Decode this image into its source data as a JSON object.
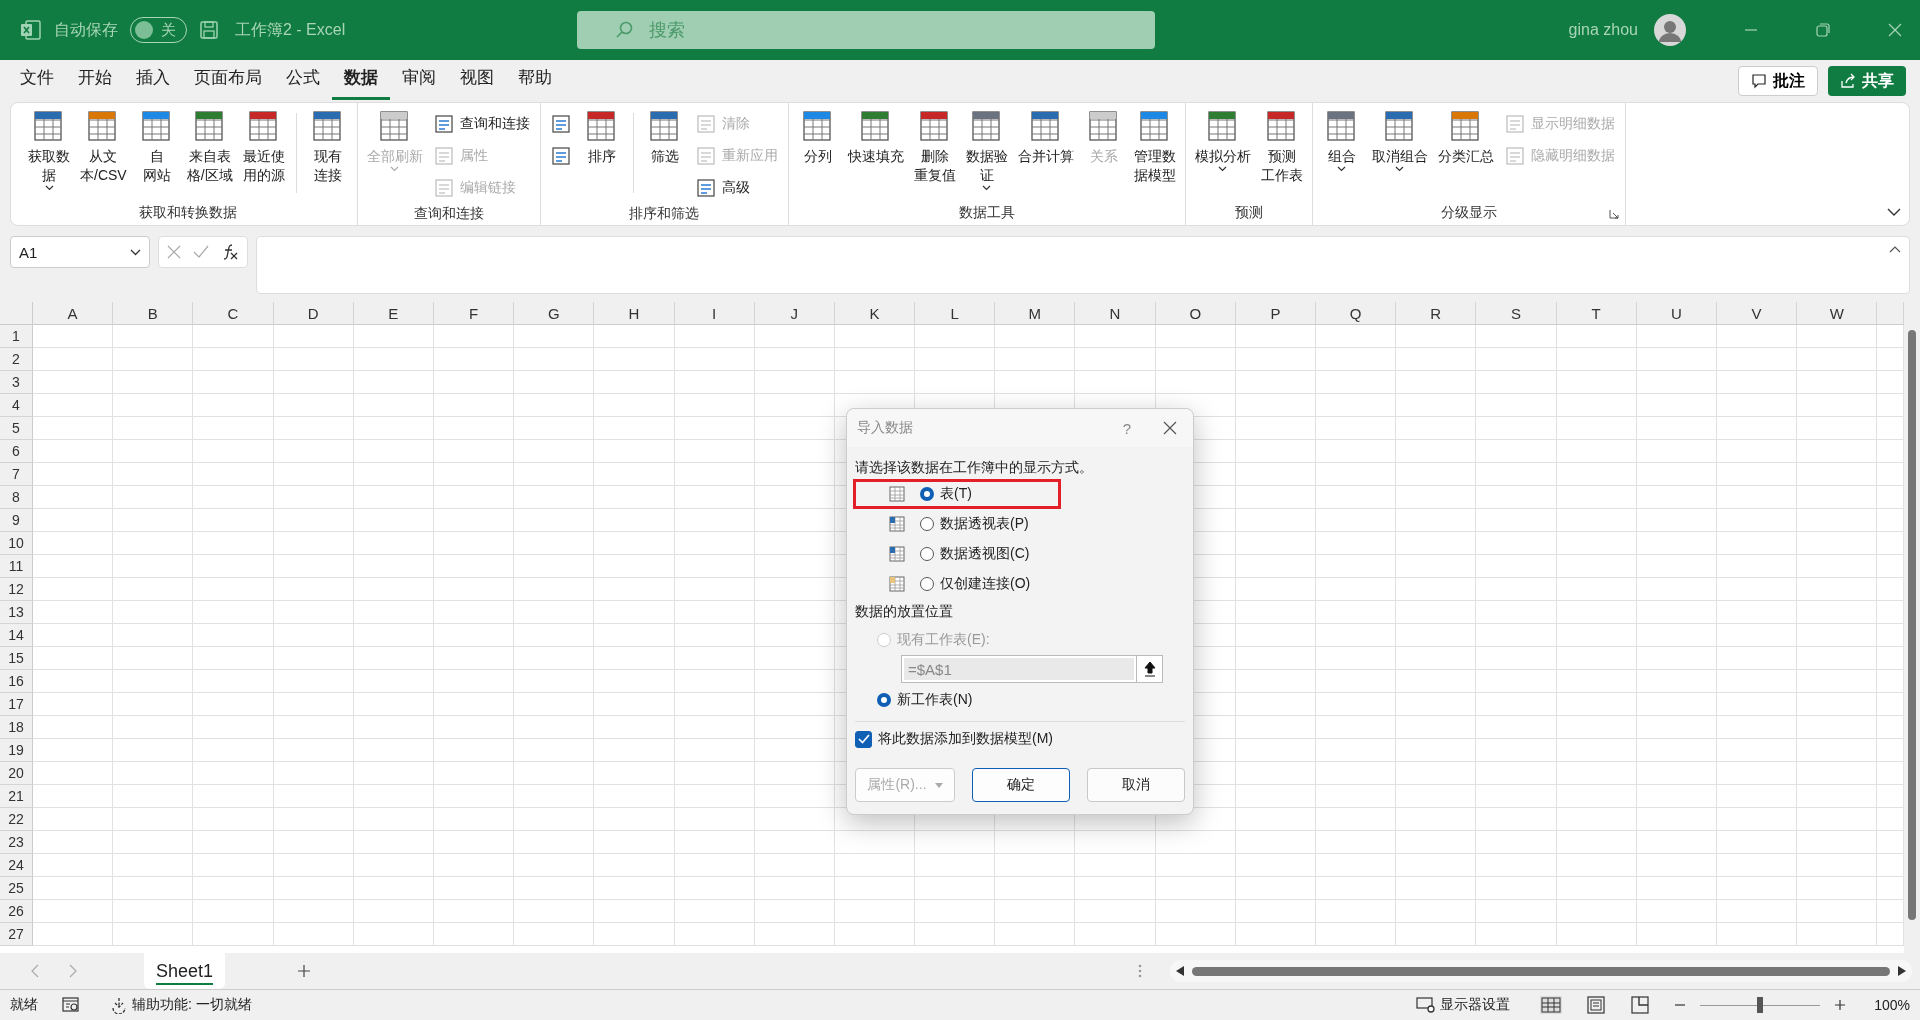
{
  "titlebar": {
    "autosave_label": "自动保存",
    "autosave_toggle": {
      "label": "关",
      "on": false
    },
    "title": "工作簿2  -  Excel",
    "search_placeholder": "搜索",
    "user": "gina zhou"
  },
  "menu_tabs": [
    {
      "label": "文件",
      "selected": false
    },
    {
      "label": "开始",
      "selected": false
    },
    {
      "label": "插入",
      "selected": false
    },
    {
      "label": "页面布局",
      "selected": false
    },
    {
      "label": "公式",
      "selected": false
    },
    {
      "label": "数据",
      "selected": true
    },
    {
      "label": "审阅",
      "selected": false
    },
    {
      "label": "视图",
      "selected": false
    },
    {
      "label": "帮助",
      "selected": false
    }
  ],
  "comment_button": "批注",
  "share_button": "共享",
  "ribbon_groups": [
    {
      "label": "获取和转换数据",
      "launcher": false,
      "items": [
        {
          "kind": "large",
          "lines": [
            "获取数",
            "据"
          ],
          "dropdown": true,
          "disabled": false
        },
        {
          "kind": "large",
          "lines": [
            "从文",
            "本/CSV"
          ],
          "dropdown": false,
          "disabled": false
        },
        {
          "kind": "large",
          "lines": [
            "自",
            "网站"
          ],
          "dropdown": false,
          "disabled": false
        },
        {
          "kind": "large",
          "lines": [
            "来自表",
            "格/区域"
          ],
          "dropdown": false,
          "disabled": false
        },
        {
          "kind": "large",
          "lines": [
            "最近使",
            "用的源"
          ],
          "dropdown": false,
          "disabled": false
        },
        {
          "kind": "divider"
        },
        {
          "kind": "large",
          "lines": [
            "现有",
            "连接"
          ],
          "dropdown": false,
          "disabled": false
        }
      ]
    },
    {
      "label": "查询和连接",
      "launcher": false,
      "items": [
        {
          "kind": "large",
          "lines": [
            "全部刷新"
          ],
          "dropdown": true,
          "disabled": true
        },
        {
          "kind": "stack",
          "items": [
            {
              "label": "查询和连接",
              "disabled": false
            },
            {
              "label": "属性",
              "disabled": true
            },
            {
              "label": "编辑链接",
              "disabled": true
            }
          ]
        }
      ]
    },
    {
      "label": "排序和筛选",
      "launcher": false,
      "items": [
        {
          "kind": "stack",
          "items": [
            {
              "disabled": false
            },
            {
              "disabled": false
            }
          ]
        },
        {
          "kind": "large",
          "lines": [
            "排序"
          ],
          "dropdown": false,
          "disabled": false
        },
        {
          "kind": "divider"
        },
        {
          "kind": "large",
          "lines": [
            "筛选"
          ],
          "dropdown": false,
          "disabled": false
        },
        {
          "kind": "stack",
          "items": [
            {
              "label": "清除",
              "disabled": true
            },
            {
              "label": "重新应用",
              "disabled": true
            },
            {
              "label": "高级",
              "disabled": false
            }
          ]
        }
      ]
    },
    {
      "label": "数据工具",
      "launcher": false,
      "items": [
        {
          "kind": "large",
          "lines": [
            "分列"
          ],
          "dropdown": false,
          "disabled": false
        },
        {
          "kind": "large",
          "lines": [
            "快速填充"
          ],
          "dropdown": false,
          "disabled": false
        },
        {
          "kind": "large",
          "lines": [
            "删除",
            "重复值"
          ],
          "dropdown": false,
          "disabled": false
        },
        {
          "kind": "large",
          "lines": [
            "数据验",
            "证"
          ],
          "dropdown": true,
          "disabled": false
        },
        {
          "kind": "large",
          "lines": [
            "合并计算"
          ],
          "dropdown": false,
          "disabled": false
        },
        {
          "kind": "large",
          "lines": [
            "关系"
          ],
          "dropdown": false,
          "disabled": true
        },
        {
          "kind": "large",
          "lines": [
            "管理数",
            "据模型"
          ],
          "dropdown": false,
          "disabled": false
        }
      ]
    },
    {
      "label": "预测",
      "launcher": false,
      "items": [
        {
          "kind": "large",
          "lines": [
            "模拟分析"
          ],
          "dropdown": true,
          "disabled": false
        },
        {
          "kind": "large",
          "lines": [
            "预测",
            "工作表"
          ],
          "dropdown": false,
          "disabled": false
        }
      ]
    },
    {
      "label": "分级显示",
      "launcher": true,
      "items": [
        {
          "kind": "large",
          "lines": [
            "组合"
          ],
          "dropdown": true,
          "disabled": false
        },
        {
          "kind": "large",
          "lines": [
            "取消组合"
          ],
          "dropdown": true,
          "disabled": false
        },
        {
          "kind": "large",
          "lines": [
            "分类汇总"
          ],
          "dropdown": false,
          "disabled": false
        },
        {
          "kind": "stack",
          "items": [
            {
              "label": "显示明细数据",
              "disabled": true
            },
            {
              "label": "隐藏明细数据",
              "disabled": true
            }
          ]
        }
      ]
    }
  ],
  "name_box": "A1",
  "columns": [
    "A",
    "B",
    "C",
    "D",
    "E",
    "F",
    "G",
    "H",
    "I",
    "J",
    "K",
    "L",
    "M",
    "N",
    "O",
    "P",
    "Q",
    "R",
    "S",
    "T",
    "U",
    "V",
    "W"
  ],
  "rows": [
    "1",
    "2",
    "3",
    "4",
    "5",
    "6",
    "7",
    "8",
    "9",
    "10",
    "11",
    "12",
    "13",
    "14",
    "15",
    "16",
    "17",
    "18",
    "19",
    "20",
    "21",
    "22",
    "23",
    "24",
    "25",
    "26",
    "27"
  ],
  "dialog": {
    "title": "导入数据",
    "help": "?",
    "prompt": "请选择该数据在工作簿中的显示方式。",
    "view_options": [
      {
        "label": "表(T)",
        "selected": true,
        "highlighted": true
      },
      {
        "label": "数据透视表(P)",
        "selected": false,
        "highlighted": false
      },
      {
        "label": "数据透视图(C)",
        "selected": false,
        "highlighted": false
      },
      {
        "label": "仅创建连接(O)",
        "selected": false,
        "highlighted": false
      }
    ],
    "placement_label": "数据的放置位置",
    "placement_options": [
      {
        "label": "现有工作表(E):",
        "selected": false,
        "disabled": true
      },
      {
        "label": "新工作表(N)",
        "selected": true,
        "disabled": false
      }
    ],
    "cell_ref": "=$A$1",
    "data_model": {
      "label": "将此数据添加到数据模型(M)",
      "checked": true
    },
    "buttons": [
      {
        "label": "属性(R)...",
        "kind": "dropdown",
        "disabled": true
      },
      {
        "label": "确定",
        "kind": "default",
        "disabled": false
      },
      {
        "label": "取消",
        "kind": "normal",
        "disabled": false
      }
    ]
  },
  "sheet_tabs": [
    {
      "label": "Sheet1",
      "selected": true
    }
  ],
  "status": {
    "ready": "就绪",
    "accessibility": "辅助功能: 一切就绪",
    "display_settings": "显示器设置",
    "zoom": "100%",
    "zoom_slider": {
      "level": 0.5
    }
  }
}
